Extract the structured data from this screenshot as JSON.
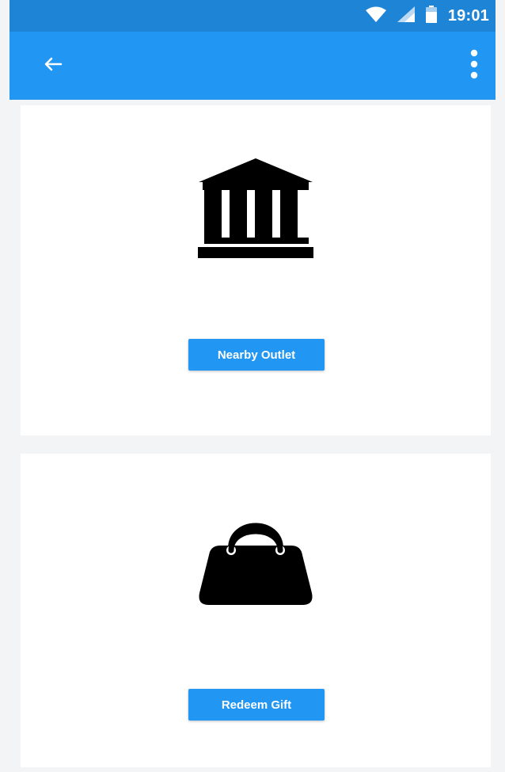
{
  "status_bar": {
    "time": "19:01",
    "icons": [
      "wifi-icon",
      "signal-icon",
      "battery-icon"
    ]
  },
  "app_bar": {
    "back_icon": "back-arrow-icon",
    "menu_icon": "more-vert-icon"
  },
  "cards": [
    {
      "icon": "bank-icon",
      "button_label": "Nearby Outlet"
    },
    {
      "icon": "shopping-bag-icon",
      "button_label": "Redeem Gift"
    }
  ],
  "colors": {
    "status_bar": "#1e84d6",
    "app_bar": "#2196f3",
    "button": "#2196f3",
    "background": "#f3f4f6",
    "card": "#ffffff",
    "icon": "#000000"
  }
}
